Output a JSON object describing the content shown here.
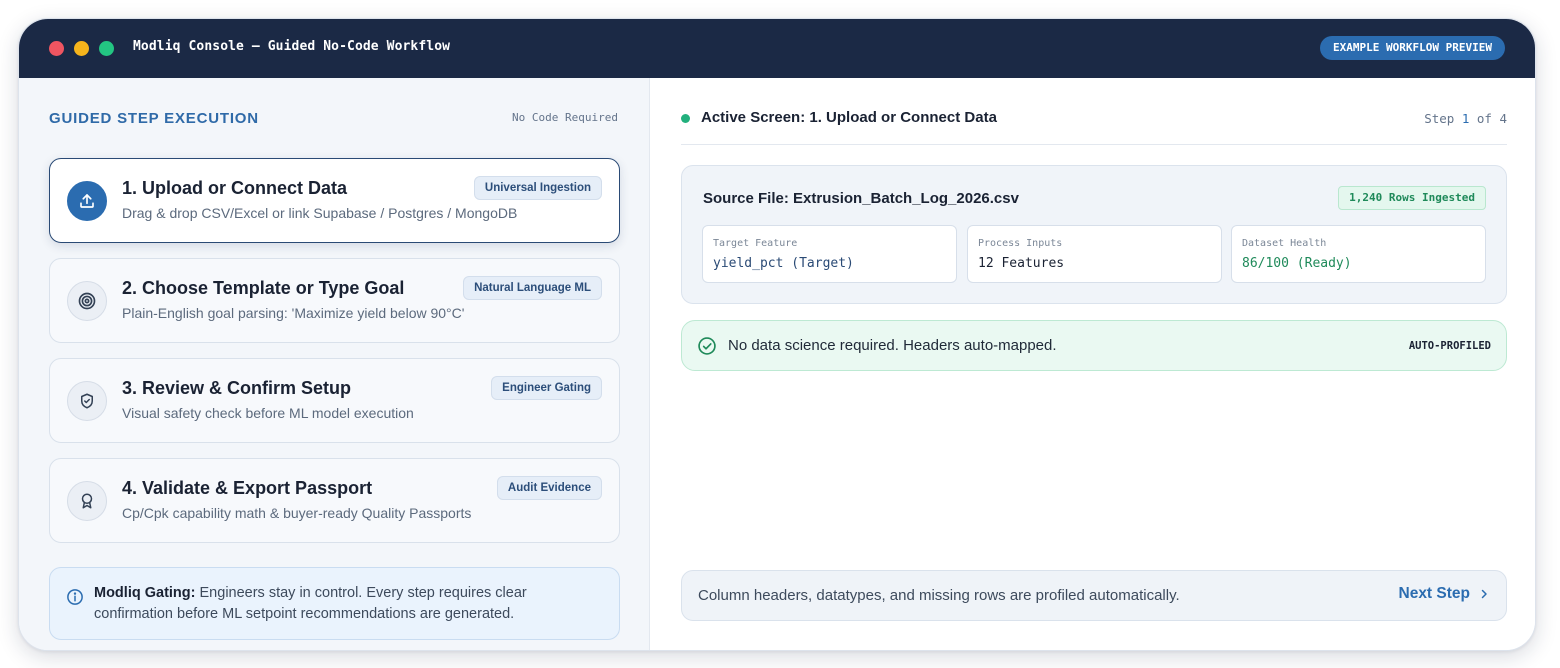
{
  "window": {
    "title": "Modliq Console — Guided No-Code Workflow",
    "badge": "EXAMPLE WORKFLOW PREVIEW"
  },
  "left_panel": {
    "heading": "GUIDED STEP EXECUTION",
    "subheading": "No Code Required",
    "steps": [
      {
        "title": "1. Upload or Connect Data",
        "description": "Drag & drop CSV/Excel or link Supabase / Postgres / MongoDB",
        "tag": "Universal Ingestion",
        "icon": "upload-icon",
        "active": true
      },
      {
        "title": "2. Choose Template or Type Goal",
        "description": "Plain-English goal parsing: 'Maximize yield below 90°C'",
        "tag": "Natural Language ML",
        "icon": "target-icon",
        "active": false
      },
      {
        "title": "3. Review & Confirm Setup",
        "description": "Visual safety check before ML model execution",
        "tag": "Engineer Gating",
        "icon": "shield-check-icon",
        "active": false
      },
      {
        "title": "4. Validate & Export Passport",
        "description": "Cp/Cpk capability math & buyer-ready Quality Passports",
        "tag": "Audit Evidence",
        "icon": "award-icon",
        "active": false
      }
    ],
    "gating": {
      "label": "Modliq Gating:",
      "text": " Engineers stay in control. Every step requires clear confirmation before ML setpoint recommendations are generated."
    }
  },
  "right_panel": {
    "active_screen": "Active Screen: 1. Upload or Connect Data",
    "step_counter": {
      "prefix": "Step ",
      "current": "1",
      "suffix": " of 4"
    },
    "source": {
      "title": "Source File: Extrusion_Batch_Log_2026.csv",
      "rows_badge": "1,240 Rows Ingested",
      "metrics": [
        {
          "label": "Target Feature",
          "value": "yield_pct (Target)"
        },
        {
          "label": "Process Inputs",
          "value": "12 Features"
        },
        {
          "label": "Dataset Health",
          "value": "86/100 (Ready)"
        }
      ]
    },
    "status": {
      "text": "No data science required. Headers auto-mapped.",
      "tag": "AUTO-PROFILED"
    },
    "footer": {
      "text": "Column headers, datatypes, and missing rows are profiled automatically.",
      "next_label": "Next Step"
    }
  },
  "colors": {
    "titlebar": "#1b2945",
    "accent": "#2b6cb0",
    "success": "#1f8a5a",
    "traffic_red": "#ef5561",
    "traffic_yellow": "#f6b41c",
    "traffic_green": "#23c582"
  }
}
